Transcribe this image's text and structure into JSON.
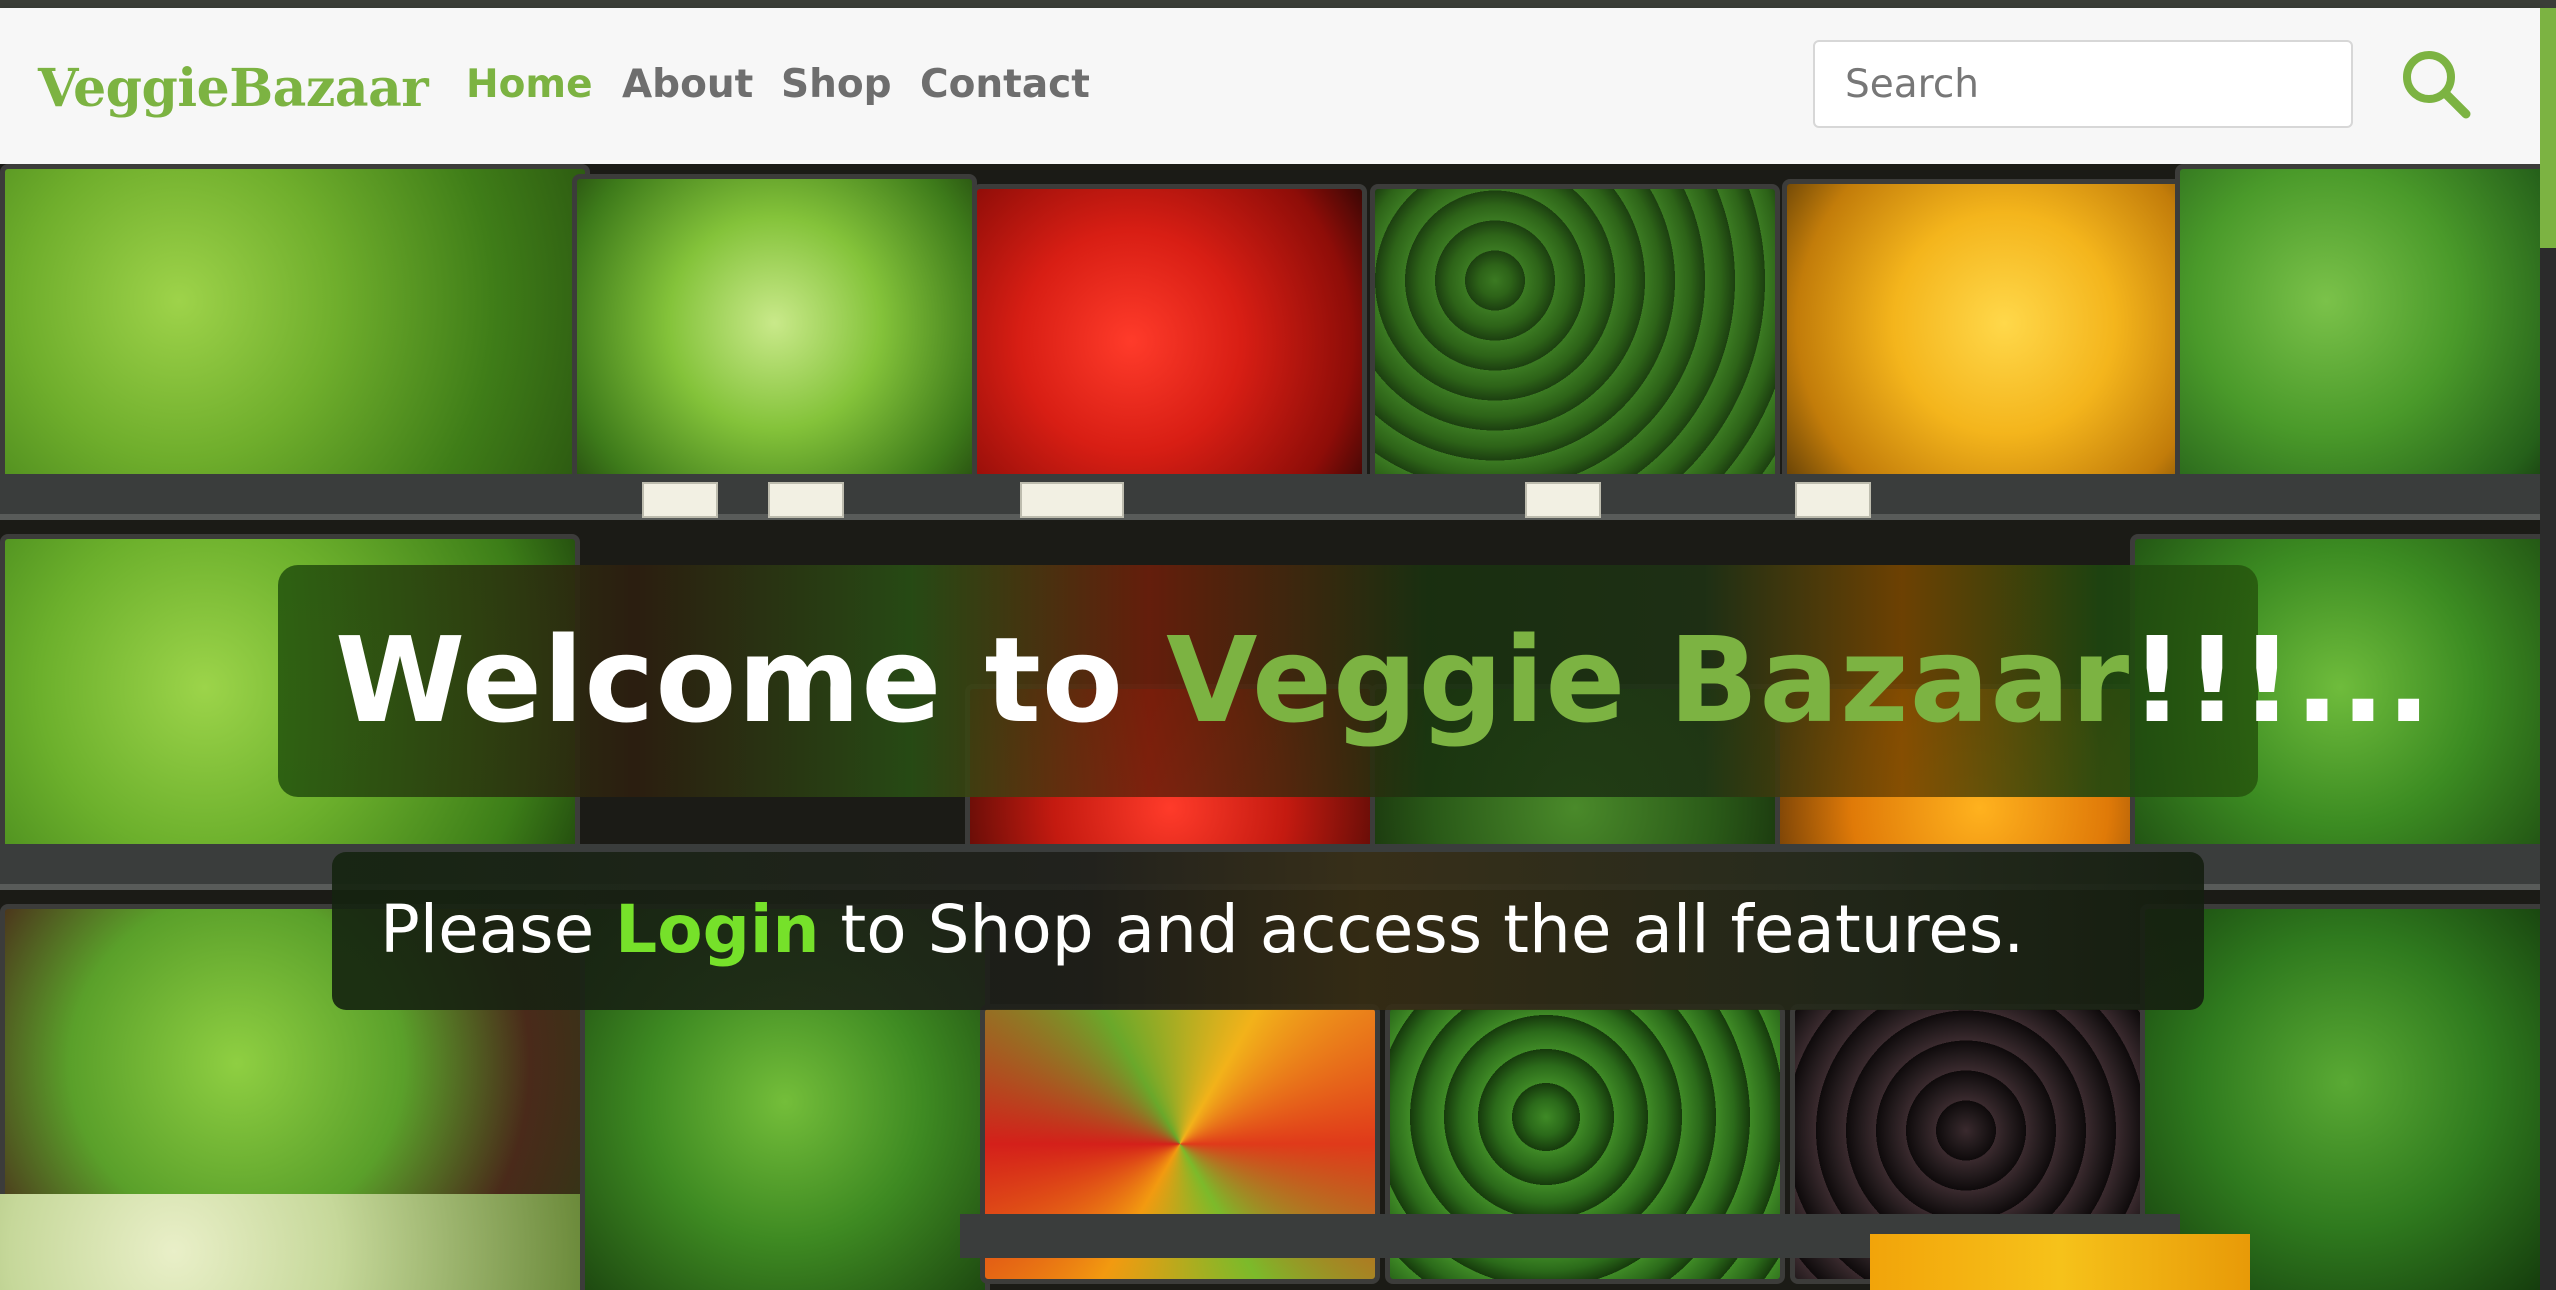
{
  "brand": "VeggieBazaar",
  "nav": {
    "links": [
      "Home",
      "About",
      "Shop",
      "Contact"
    ],
    "active": "Home"
  },
  "search": {
    "placeholder": "Search",
    "button_icon": "search-icon"
  },
  "hero": {
    "welcome_prefix": "Welcome to ",
    "welcome_highlight": "Veggie Bazaar",
    "welcome_suffix": "!!!...",
    "login_prefix": "Please ",
    "login_link": "Login",
    "login_suffix": " to Shop and access the all features.",
    "background": "vegetable-market-shelves-image"
  },
  "colors": {
    "brand_green": "#7cb342",
    "login_link_green": "#76e12a",
    "nav_text": "#6e6e6e",
    "navbar_bg": "#f7f7f7"
  }
}
